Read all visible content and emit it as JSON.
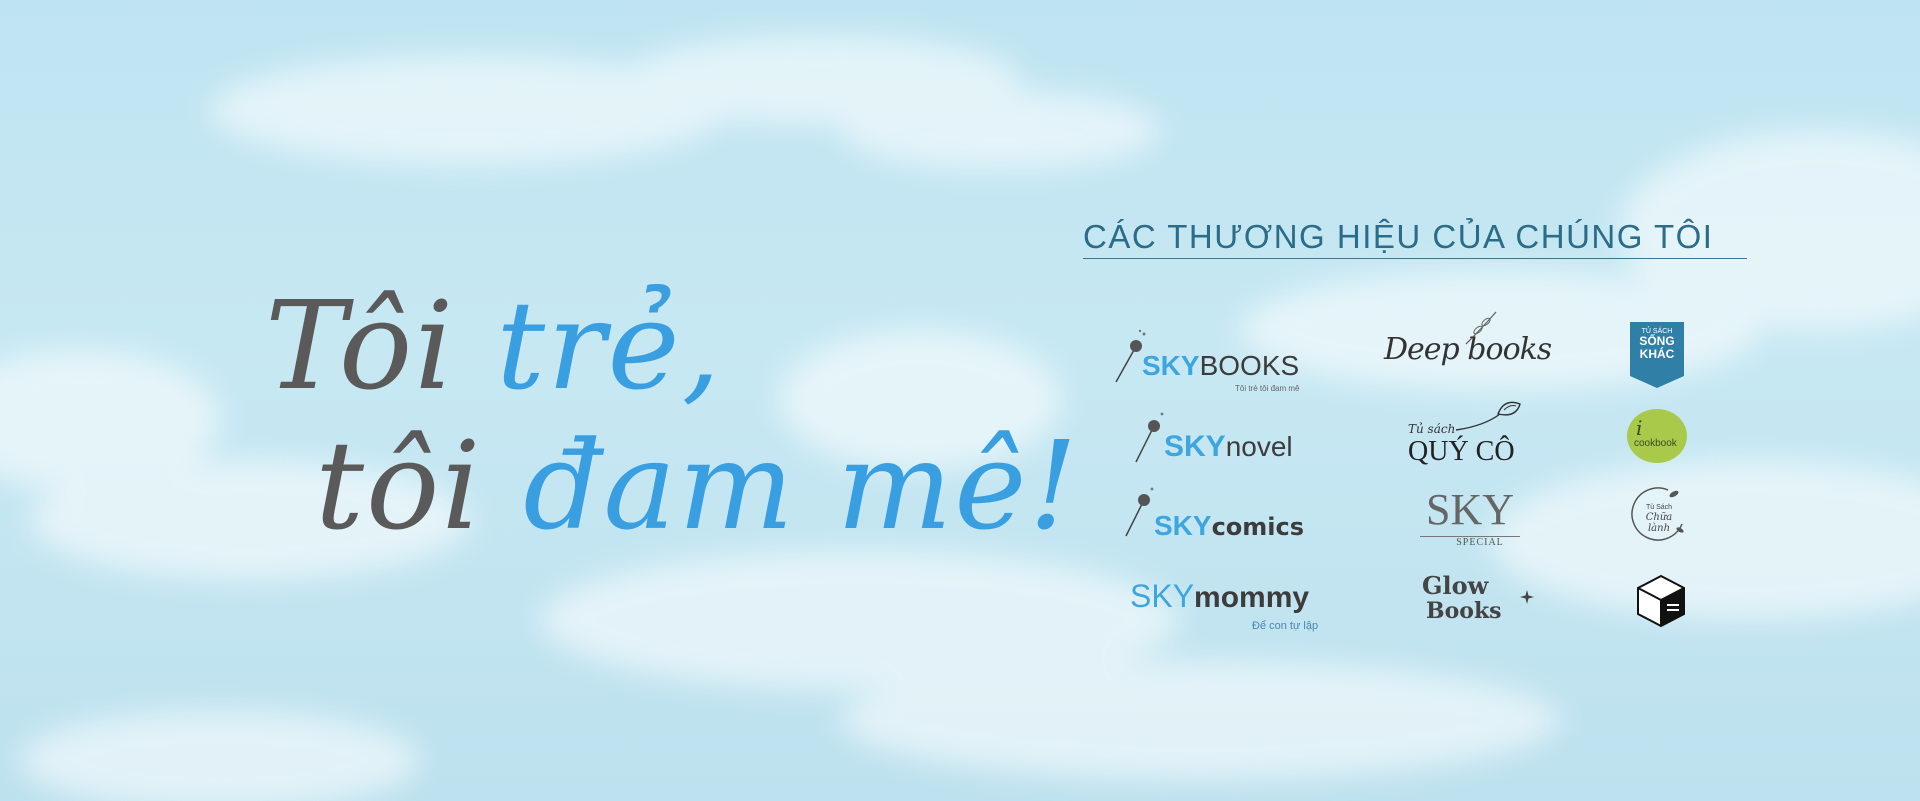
{
  "tagline": {
    "line1": {
      "part1": "Tôi ",
      "part2": "trẻ,"
    },
    "line2": {
      "part1": "tôi ",
      "part2": "đam mê!"
    }
  },
  "brands": {
    "title": "CÁC THƯƠNG HIỆU CỦA CHÚNG TÔI",
    "skybooks": {
      "sky": "SKY",
      "name": "BOOKS",
      "sub": "Tôi trẻ tôi đam mê"
    },
    "skynovel": {
      "sky": "SKY",
      "name": "novel"
    },
    "skycomics": {
      "sky": "SKY",
      "name": "comics"
    },
    "skymommy": {
      "sky": "SKY",
      "name": "mommy",
      "sub": "Để con tự lập"
    },
    "deepbooks": {
      "name": "Deep books"
    },
    "quyco": {
      "small": "Tủ sách",
      "name": "QUÝ CÔ"
    },
    "skyspecial": {
      "name": "SKY",
      "sub": "SPECIAL"
    },
    "glowbooks": {
      "line1": "Glow",
      "line2": "Books"
    },
    "songkhac": {
      "line1": "TỦ SÁCH",
      "line2": "SỐNG",
      "line3": "KHÁC"
    },
    "icookbook": {
      "i": "i",
      "name": "cookbook"
    },
    "chualanh": {
      "line1": "Tủ Sách",
      "line2": "Chữa lành"
    }
  },
  "colors": {
    "accent": "#3a9fe0",
    "title": "#2b6c88",
    "text_dark": "#5a5a5a"
  }
}
